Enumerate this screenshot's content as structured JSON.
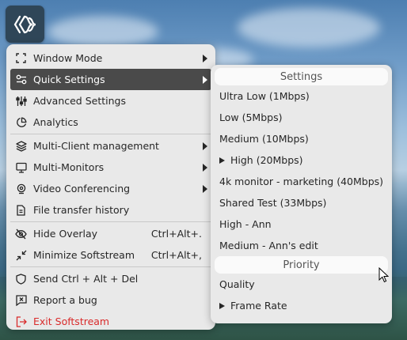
{
  "main_menu": {
    "items": [
      {
        "label": "Window Mode",
        "icon": "fullscreen-icon",
        "submenu": true
      },
      {
        "label": "Quick Settings",
        "icon": "toggles-icon",
        "submenu": true,
        "active": true
      },
      {
        "label": "Advanced Settings",
        "icon": "sliders-icon"
      },
      {
        "label": "Analytics",
        "icon": "pie-chart-icon"
      },
      {
        "label": "Multi-Client management",
        "icon": "layers-icon",
        "submenu": true
      },
      {
        "label": "Multi-Monitors",
        "icon": "monitor-icon",
        "submenu": true
      },
      {
        "label": "Video Conferencing",
        "icon": "webcam-icon",
        "submenu": true
      },
      {
        "label": "File transfer history",
        "icon": "file-icon"
      },
      {
        "label": "Hide Overlay",
        "icon": "eye-off-icon",
        "shortcut": "Ctrl+Alt+."
      },
      {
        "label": "Minimize Softstream",
        "icon": "minimize-icon",
        "shortcut": "Ctrl+Alt+,"
      },
      {
        "label": "Send Ctrl + Alt + Del",
        "icon": "shield-icon"
      },
      {
        "label": "Report a bug",
        "icon": "bug-report-icon"
      },
      {
        "label": "Exit Softstream",
        "icon": "exit-icon"
      }
    ]
  },
  "quick_settings": {
    "settings_header": "Settings",
    "settings": [
      {
        "label": "Ultra Low (1Mbps)"
      },
      {
        "label": "Low (5Mbps)"
      },
      {
        "label": "Medium (10Mbps)"
      },
      {
        "label": "High (20Mbps)",
        "selected": true
      },
      {
        "label": "4k monitor - marketing (40Mbps)"
      },
      {
        "label": "Shared Test (33Mbps)"
      },
      {
        "label": "High - Ann"
      },
      {
        "label": "Medium - Ann's edit"
      }
    ],
    "priority_header": "Priority",
    "priority": [
      {
        "label": "Quality"
      },
      {
        "label": "Frame Rate",
        "selected": true
      }
    ]
  },
  "colors": {
    "menu_bg": "#e9e9e9",
    "active_bg": "#4a4a4a",
    "danger": "#d92b2b"
  }
}
